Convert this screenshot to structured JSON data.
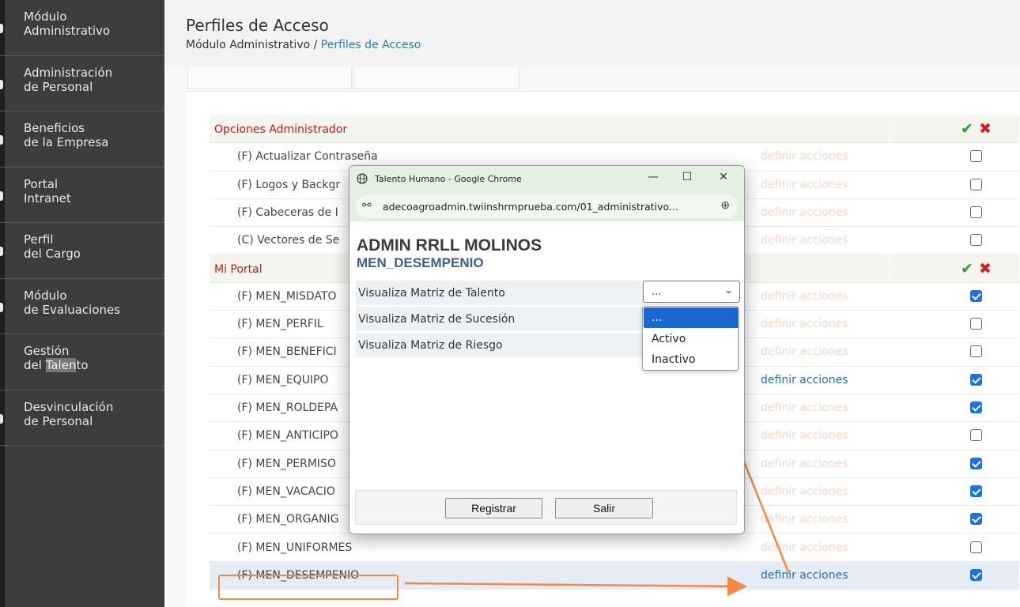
{
  "sidebar": {
    "items": [
      {
        "line1": "Módulo",
        "line2": "Administrativo"
      },
      {
        "line1": "Administración",
        "line2": "de Personal"
      },
      {
        "line1": "Beneficios",
        "line2": "de la Empresa"
      },
      {
        "line1": "Portal",
        "line2": "Intranet"
      },
      {
        "line1": "Perfil",
        "line2": "del Cargo"
      },
      {
        "line1": "Módulo",
        "line2": "de Evaluaciones"
      },
      {
        "line1": "Gestión",
        "line2_pre": "del ",
        "line2_hl": "Talen",
        "line2_post": "to"
      },
      {
        "line1": "Desvinculación",
        "line2": "de Personal"
      }
    ]
  },
  "header": {
    "title": "Perfiles de Acceso",
    "breadcrumb_root": "Módulo Administrativo / ",
    "breadcrumb_current": "Perfiles de Acceso"
  },
  "groups": {
    "admin": "Opciones Administrador",
    "portal": "Mi Portal",
    "ok_icon": "✔",
    "x_icon": "✖"
  },
  "action_label": "definir acciones",
  "admin_rows": [
    {
      "name": "(F) Actualizar Contraseña",
      "checked": false
    },
    {
      "name": "(F) Logos y Backgr",
      "checked": false
    },
    {
      "name": "(F) Cabeceras de I",
      "checked": false
    },
    {
      "name": "(C) Vectores de Se",
      "checked": false
    }
  ],
  "portal_rows": [
    {
      "name": "(F) MEN_MISDATO",
      "checked": true
    },
    {
      "name": "(F) MEN_PERFIL",
      "checked": false
    },
    {
      "name": "(F) MEN_BENEFICI",
      "checked": false
    },
    {
      "name": "(F) MEN_EQUIPO",
      "checked": true
    },
    {
      "name": "(F) MEN_ROLDEPA",
      "checked": true
    },
    {
      "name": "(F) MEN_ANTICIPO",
      "checked": false
    },
    {
      "name": "(F) MEN_PERMISO",
      "checked": true
    },
    {
      "name": "(F) MEN_VACACIO",
      "checked": true
    },
    {
      "name": "(F) MEN_ORGANIG",
      "checked": true
    },
    {
      "name": "(F) MEN_UNIFORMES",
      "checked": false
    },
    {
      "name": "(F) MEN_DESEMPENIO",
      "checked": true
    }
  ],
  "popup": {
    "window_title": "Talento Humano - Google Chrome",
    "url": "adecoagroadmin.twiinshrmprueba.com/01_administrativo...",
    "heading": "ADMIN RRLL MOLINOS",
    "subheading": "MEN_DESEMPENIO",
    "options": [
      "Visualiza Matriz de Talento",
      "Visualiza Matriz de Sucesión",
      "Visualiza Matriz de Riesgo"
    ],
    "select_value": "...",
    "dropdown_options": [
      "...",
      "Activo",
      "Inactivo"
    ],
    "register_button": "Registrar",
    "exit_button": "Salir",
    "minimize": "—",
    "maximize": "☐",
    "close": "✕",
    "site_icon": "⚯",
    "zoom_icon": "⊕"
  },
  "colors": {
    "sidebar_bg": "#3d3d3d",
    "group_title": "#c01b1b",
    "link_active": "#1f6fb3",
    "link_faded": "#f6d6c8",
    "annotation": "#f08a44",
    "popup_chrome": "#e3f1e1"
  }
}
